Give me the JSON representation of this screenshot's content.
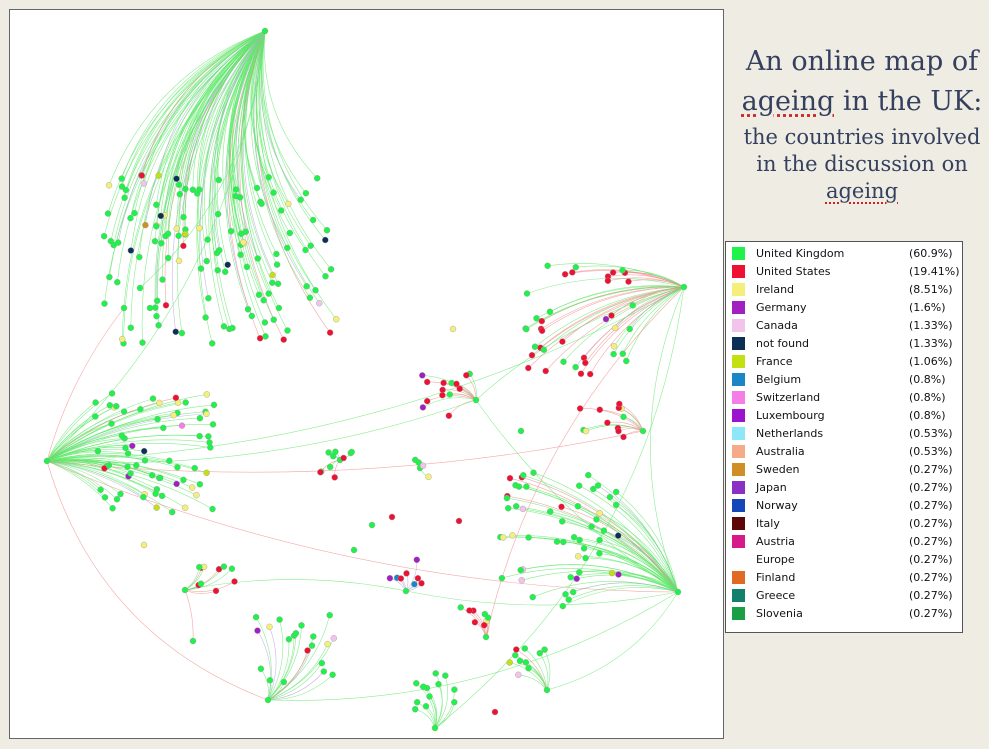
{
  "title": {
    "line1": "An online map of",
    "line2_word": "ageing",
    "line2_rest": " in the UK:",
    "sub_line1": "the countries involved",
    "sub_line2": "in the discussion on",
    "sub_line3": "ageing"
  },
  "legend": {
    "items": [
      {
        "label": "United Kingdom",
        "pct": "(60.9%)",
        "color": "#1ff24a"
      },
      {
        "label": "United States",
        "pct": "(19.41%)",
        "color": "#ee1133"
      },
      {
        "label": "Ireland",
        "pct": "(8.51%)",
        "color": "#f4ef7a"
      },
      {
        "label": "Germany",
        "pct": "(1.6%)",
        "color": "#a020c0"
      },
      {
        "label": "Canada",
        "pct": "(1.33%)",
        "color": "#f2c4ec"
      },
      {
        "label": "not found",
        "pct": "(1.33%)",
        "color": "#0c2f55"
      },
      {
        "label": "France",
        "pct": "(1.06%)",
        "color": "#c4e010"
      },
      {
        "label": "Belgium",
        "pct": "(0.8%)",
        "color": "#1a86c8"
      },
      {
        "label": "Switzerland",
        "pct": "(0.8%)",
        "color": "#f57ee6"
      },
      {
        "label": "Luxembourg",
        "pct": "(0.8%)",
        "color": "#9b12cf"
      },
      {
        "label": "Netherlands",
        "pct": "(0.53%)",
        "color": "#8ce8f6"
      },
      {
        "label": "Australia",
        "pct": "(0.53%)",
        "color": "#f5aa8a"
      },
      {
        "label": "Sweden",
        "pct": "(0.27%)",
        "color": "#d08e26"
      },
      {
        "label": "Japan",
        "pct": "(0.27%)",
        "color": "#8a30c4"
      },
      {
        "label": "Norway",
        "pct": "(0.27%)",
        "color": "#1448b8"
      },
      {
        "label": "Italy",
        "pct": "(0.27%)",
        "color": "#5c0808"
      },
      {
        "label": "Austria",
        "pct": "(0.27%)",
        "color": "#d61a8a"
      },
      {
        "label": "Europe",
        "pct": "(0.27%)",
        "color": "#ffffff"
      },
      {
        "label": "Finland",
        "pct": "(0.27%)",
        "color": "#e06a24"
      },
      {
        "label": "Greece",
        "pct": "(0.27%)",
        "color": "#12806a"
      },
      {
        "label": "Slovenia",
        "pct": "(0.27%)",
        "color": "#1aa044"
      }
    ]
  },
  "graph": {
    "edge_colors": {
      "uk": "#5fe86a",
      "us": "#f08a8a",
      "mixed": "#b8a0e0"
    }
  }
}
